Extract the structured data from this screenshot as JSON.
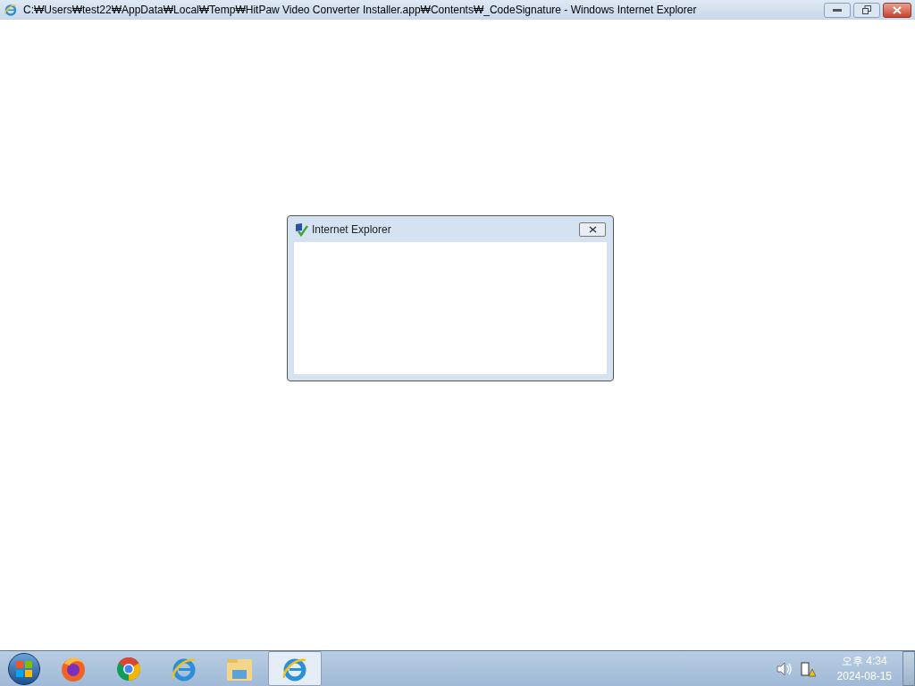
{
  "window": {
    "title": "C:₩Users₩test22₩AppData₩Local₩Temp₩HitPaw Video Converter Installer.app₩Contents₩_CodeSignature - Windows Internet Explorer"
  },
  "dialog": {
    "title": "Internet Explorer"
  },
  "taskbar": {
    "items": [
      {
        "kind": "firefox",
        "selected": false
      },
      {
        "kind": "chrome",
        "selected": false
      },
      {
        "kind": "ie",
        "selected": false
      },
      {
        "kind": "folder",
        "selected": false
      },
      {
        "kind": "ie",
        "selected": true
      }
    ],
    "clock": {
      "time": "오후 4:34",
      "date": "2024-08-15"
    }
  }
}
